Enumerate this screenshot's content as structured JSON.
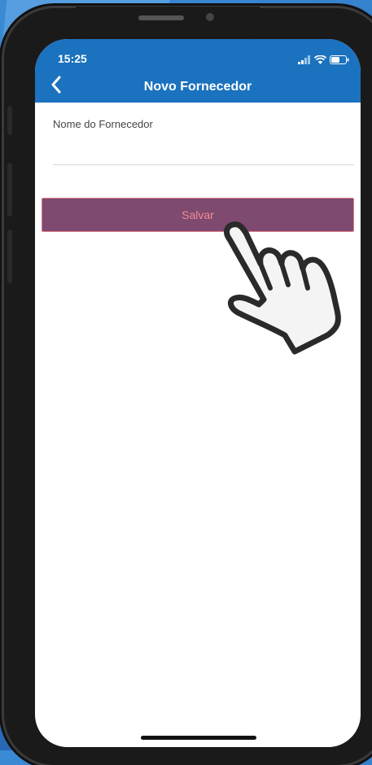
{
  "status_bar": {
    "time": "15:25"
  },
  "nav": {
    "title": "Novo Fornecedor",
    "back_icon": "chevron-left-icon"
  },
  "form": {
    "supplier_name_label": "Nome do Fornecedor",
    "supplier_name_value": ""
  },
  "actions": {
    "save_label": "Salvar"
  },
  "colors": {
    "header": "#1b72be",
    "save_button_bg": "#7e4a6f",
    "save_button_text": "#f28c95"
  }
}
